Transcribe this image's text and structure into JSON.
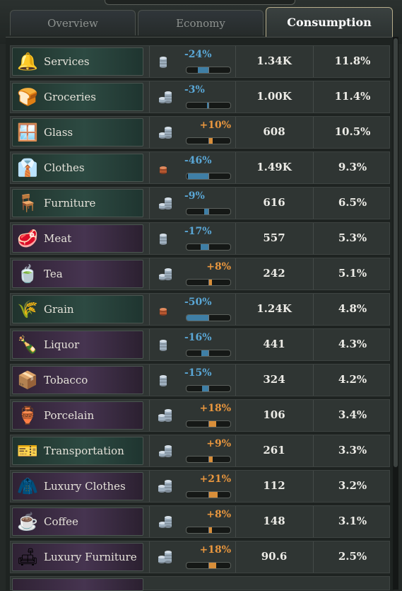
{
  "tabs": [
    {
      "label": "Overview",
      "active": false
    },
    {
      "label": "Economy",
      "active": false
    },
    {
      "label": "Consumption",
      "active": true
    }
  ],
  "colors": {
    "negative_change": "#5aa7d6",
    "positive_change": "#e8963e",
    "active_tab_border": "#b7ad8b"
  },
  "goods": [
    {
      "name": "Services",
      "icon": "bell-icon",
      "glyph": "🔔",
      "theme": "green",
      "coin": "silver-low",
      "change": "-24%",
      "change_value": -24,
      "amount": "1.34K",
      "share": "11.8%"
    },
    {
      "name": "Groceries",
      "icon": "groceries-icon",
      "glyph": "🍞",
      "theme": "green",
      "coin": "silver-stack",
      "change": "-3%",
      "change_value": -3,
      "amount": "1.00K",
      "share": "11.4%"
    },
    {
      "name": "Glass",
      "icon": "glass-icon",
      "glyph": "🪟",
      "theme": "green",
      "coin": "silver-stack",
      "change": "+10%",
      "change_value": 10,
      "amount": "608",
      "share": "10.5%"
    },
    {
      "name": "Clothes",
      "icon": "clothes-icon",
      "glyph": "👔",
      "theme": "green",
      "coin": "copper-low",
      "change": "-46%",
      "change_value": -46,
      "amount": "1.49K",
      "share": "9.3%"
    },
    {
      "name": "Furniture",
      "icon": "chair-icon",
      "glyph": "🪑",
      "theme": "green",
      "coin": "silver-stack",
      "change": "-9%",
      "change_value": -9,
      "amount": "616",
      "share": "6.5%"
    },
    {
      "name": "Meat",
      "icon": "meat-icon",
      "glyph": "🥩",
      "theme": "purple",
      "coin": "silver-low",
      "change": "-17%",
      "change_value": -17,
      "amount": "557",
      "share": "5.3%"
    },
    {
      "name": "Tea",
      "icon": "teacup-icon",
      "glyph": "🍵",
      "theme": "purple",
      "coin": "silver-stack",
      "change": "+8%",
      "change_value": 8,
      "amount": "242",
      "share": "5.1%"
    },
    {
      "name": "Grain",
      "icon": "wheat-icon",
      "glyph": "🌾",
      "theme": "green",
      "coin": "copper-low",
      "change": "-50%",
      "change_value": -50,
      "amount": "1.24K",
      "share": "4.8%"
    },
    {
      "name": "Liquor",
      "icon": "liquor-bottle-icon",
      "glyph": "🍾",
      "theme": "purple",
      "coin": "silver-low",
      "change": "-16%",
      "change_value": -16,
      "amount": "441",
      "share": "4.3%"
    },
    {
      "name": "Tobacco",
      "icon": "cigar-box-icon",
      "glyph": "📦",
      "theme": "purple",
      "coin": "silver-low",
      "change": "-15%",
      "change_value": -15,
      "amount": "324",
      "share": "4.2%"
    },
    {
      "name": "Porcelain",
      "icon": "vase-icon",
      "glyph": "🏺",
      "theme": "purple",
      "coin": "silver-stack-double",
      "change": "+18%",
      "change_value": 18,
      "amount": "106",
      "share": "3.4%"
    },
    {
      "name": "Transportation",
      "icon": "ticket-icon",
      "glyph": "🎫",
      "theme": "green",
      "coin": "silver-stack",
      "change": "+9%",
      "change_value": 9,
      "amount": "261",
      "share": "3.3%"
    },
    {
      "name": "Luxury Clothes",
      "icon": "luxury-clothes-icon",
      "glyph": "🧥",
      "theme": "purple",
      "coin": "silver-stack-double",
      "change": "+21%",
      "change_value": 21,
      "amount": "112",
      "share": "3.2%"
    },
    {
      "name": "Coffee",
      "icon": "coffee-icon",
      "glyph": "☕",
      "theme": "purple",
      "coin": "silver-stack",
      "change": "+8%",
      "change_value": 8,
      "amount": "148",
      "share": "3.1%"
    },
    {
      "name": "Luxury Furniture",
      "icon": "armchair-icon",
      "glyph": "🛋",
      "theme": "purple",
      "coin": "silver-stack-double",
      "change": "+18%",
      "change_value": 18,
      "amount": "90.6",
      "share": "2.5%"
    }
  ]
}
